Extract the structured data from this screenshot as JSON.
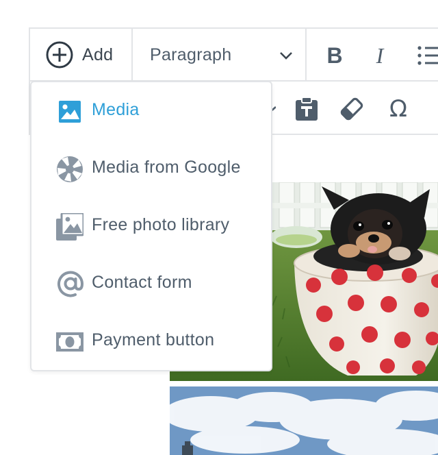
{
  "toolbar": {
    "add_label": "Add",
    "block_type": "Paragraph",
    "bold_label": "B",
    "italic_label": "I",
    "special_char_label": "Ω"
  },
  "inserter_menu": {
    "items": [
      {
        "label": "Media",
        "icon": "image-icon",
        "active": true
      },
      {
        "label": "Media from Google",
        "icon": "aperture-icon",
        "active": false
      },
      {
        "label": "Free photo library",
        "icon": "photo-library-icon",
        "active": false
      },
      {
        "label": "Contact form",
        "icon": "at-sign-icon",
        "active": false
      },
      {
        "label": "Payment button",
        "icon": "banknote-icon",
        "active": false
      }
    ]
  },
  "colors": {
    "accent": "#2e9fd8",
    "text": "#4f5d6b",
    "icon_muted": "#8a96a3",
    "border": "#e2e4e7"
  }
}
